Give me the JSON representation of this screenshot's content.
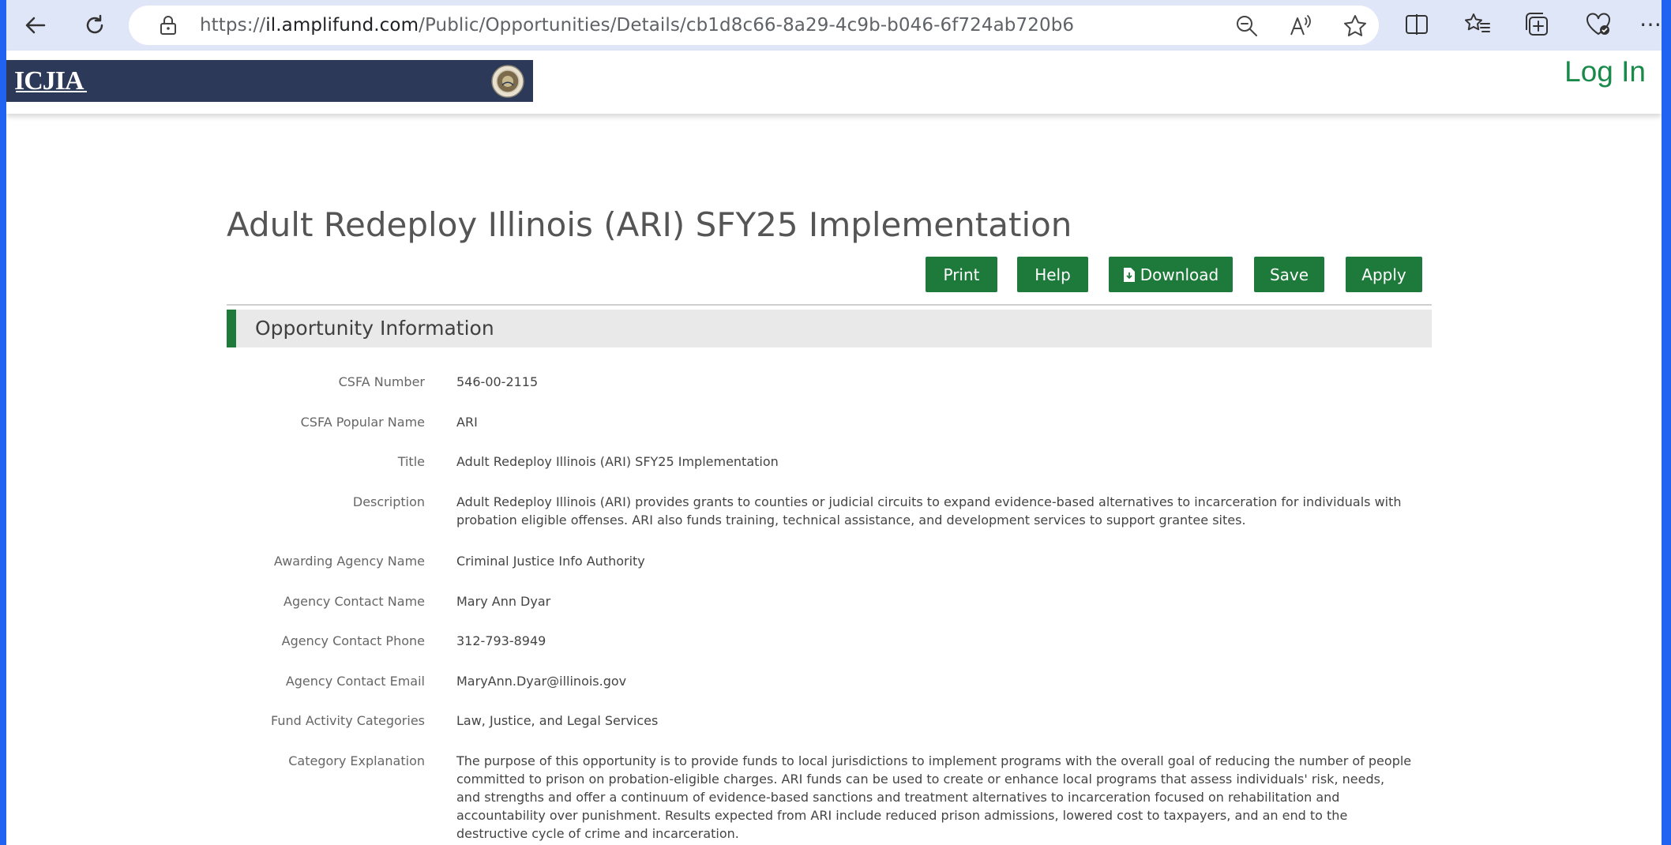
{
  "browser": {
    "url_prefix": "https://",
    "url_domain": "il.amplifund.com",
    "url_path": "/Public/Opportunities/Details/cb1d8c66-8a29-4c9b-b046-6f724ab720b6"
  },
  "site": {
    "logo_text": "ICJIA",
    "login": "Log In",
    "accent_color": "#1e7a3a",
    "header_color": "#2d3958"
  },
  "page": {
    "title": "Adult Redeploy Illinois (ARI) SFY25 Implementation"
  },
  "actions": {
    "print": "Print",
    "help": "Help",
    "download": "Download",
    "save": "Save",
    "apply": "Apply"
  },
  "section": {
    "title": "Opportunity Information"
  },
  "fields": [
    {
      "label": "CSFA Number",
      "value": "546-00-2115"
    },
    {
      "label": "CSFA Popular Name",
      "value": "ARI"
    },
    {
      "label": "Title",
      "value": "Adult Redeploy Illinois (ARI) SFY25 Implementation"
    },
    {
      "label": "Description",
      "value": "Adult Redeploy Illinois (ARI) provides grants to counties or judicial circuits to expand evidence-based alternatives to incarceration for individuals with probation eligible offenses. ARI also funds training, technical assistance, and development services to support grantee sites."
    },
    {
      "label": "Awarding Agency Name",
      "value": "Criminal Justice Info Authority"
    },
    {
      "label": "Agency Contact Name",
      "value": "Mary Ann Dyar"
    },
    {
      "label": "Agency Contact Phone",
      "value": "312-793-8949"
    },
    {
      "label": "Agency Contact Email",
      "value": "MaryAnn.Dyar@illinois.gov"
    },
    {
      "label": "Fund Activity Categories",
      "value": "Law, Justice, and Legal Services"
    },
    {
      "label": "Category Explanation",
      "value": "The purpose of this opportunity is to provide funds to local jurisdictions to implement programs with the overall goal of reducing the number of people committed to prison on probation-eligible charges. ARI funds can be used to create or enhance local programs that assess individuals' risk, needs, and strengths and offer a continuum of evidence-based sanctions and treatment alternatives to incarceration focused on rehabilitation and accountability over punishment. Results expected from ARI include reduced prison admissions, lowered cost to taxpayers, and an end to the destructive cycle of crime and incarceration."
    }
  ]
}
